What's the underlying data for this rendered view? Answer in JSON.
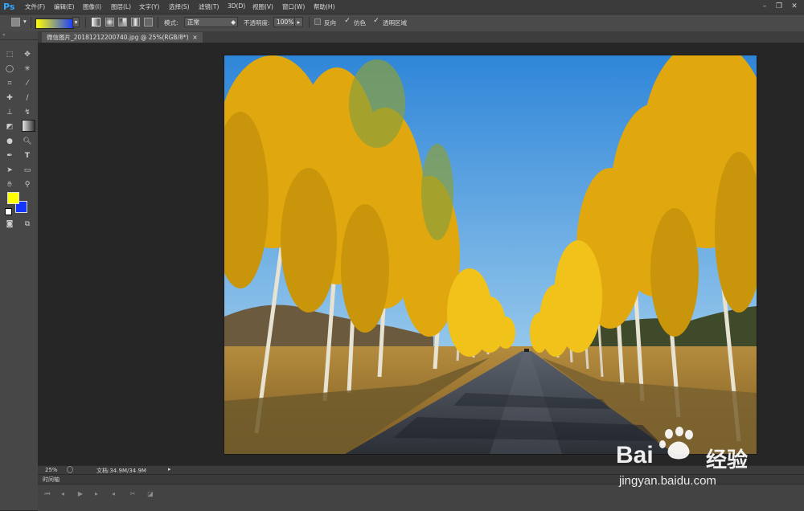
{
  "app": {
    "logo": "Ps"
  },
  "menu": [
    "文件(F)",
    "编辑(E)",
    "图像(I)",
    "图层(L)",
    "文字(Y)",
    "选择(S)",
    "滤镜(T)",
    "3D(D)",
    "视图(V)",
    "窗口(W)",
    "帮助(H)"
  ],
  "window_controls": {
    "minimize": "–",
    "restore": "❐",
    "close": "✕"
  },
  "options": {
    "mode_label": "模式:",
    "mode_value": "正常",
    "opacity_label": "不透明度:",
    "opacity_value": "100%",
    "reverse_label": "反向",
    "dither_label": "仿色",
    "transparency_label": "透明区域",
    "dither_checked": true,
    "transparency_checked": true,
    "reverse_checked": false,
    "gradient_colors": [
      "#ffff00",
      "#1a3cff"
    ]
  },
  "document": {
    "tab_title": "微信图片_20181212200740.jpg @ 25%(RGB/8*)",
    "tab_close": "×"
  },
  "colors": {
    "foreground": "#ffff00",
    "background": "#1434ff",
    "accent": "#31a8ff"
  },
  "tools": [
    "marquee-icon",
    "move-icon",
    "lasso-icon",
    "magic-wand-icon",
    "crop-icon",
    "eyedropper-icon",
    "spot-heal-icon",
    "brush-icon",
    "stamp-icon",
    "history-brush-icon",
    "eraser-icon",
    "gradient-icon",
    "blur-icon",
    "dodge-icon",
    "pen-icon",
    "type-icon",
    "path-select-icon",
    "shape-icon",
    "hand-icon",
    "zoom-icon"
  ],
  "status": {
    "zoom": "25%",
    "doc_info": "文档:34.9M/34.9M"
  },
  "timeline": {
    "title": "时间轴"
  },
  "watermark": {
    "brand_a": "Bai",
    "brand_b": "经验",
    "url": "jingyan.baidu.com"
  }
}
